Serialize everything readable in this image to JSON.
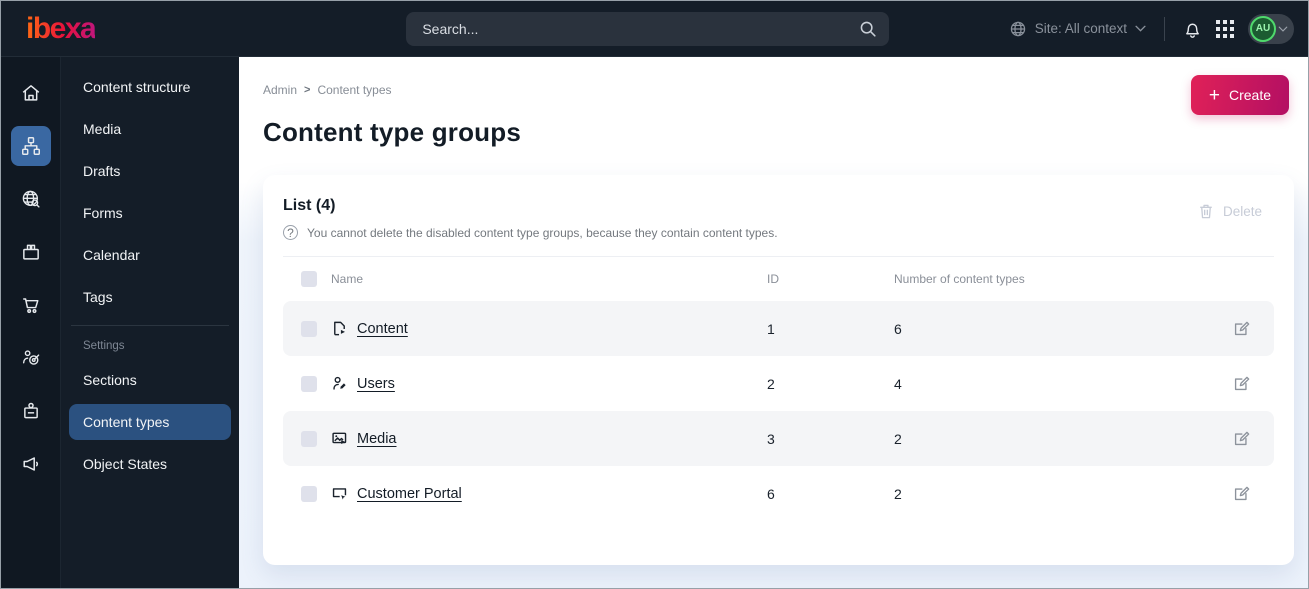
{
  "topbar": {
    "logo": "ibexa",
    "search_placeholder": "Search...",
    "site_context": "Site: All context",
    "avatar": "AU"
  },
  "icon_rail": {
    "items": [
      {
        "name": "home",
        "active": false
      },
      {
        "name": "content-structure",
        "active": true
      },
      {
        "name": "site",
        "active": false
      },
      {
        "name": "products",
        "active": false
      },
      {
        "name": "commerce",
        "active": false
      },
      {
        "name": "personalization",
        "active": false
      },
      {
        "name": "admin",
        "active": false
      },
      {
        "name": "engage",
        "active": false
      }
    ]
  },
  "sidebar": {
    "items": [
      {
        "label": "Content structure"
      },
      {
        "label": "Media"
      },
      {
        "label": "Drafts"
      },
      {
        "label": "Forms"
      },
      {
        "label": "Calendar"
      },
      {
        "label": "Tags"
      }
    ],
    "settings_header": "Settings",
    "settings_items": [
      {
        "label": "Sections",
        "active": false
      },
      {
        "label": "Content types",
        "active": true
      },
      {
        "label": "Object States",
        "active": false
      }
    ]
  },
  "main": {
    "breadcrumb": [
      "Admin",
      "Content types"
    ],
    "breadcrumb_sep": ">",
    "create_plus": "+",
    "create_label": "Create",
    "title": "Content type groups",
    "list": {
      "heading": "List (4)",
      "info_icon": "?",
      "info": "You cannot delete the disabled content type groups, because they contain content types.",
      "delete_label": "Delete",
      "table": {
        "columns": [
          "Name",
          "ID",
          "Number of content types"
        ],
        "rows": [
          {
            "icon": "content-file-icon",
            "name": "Content",
            "id": "1",
            "count": "6"
          },
          {
            "icon": "user-edit-icon",
            "name": "Users",
            "id": "2",
            "count": "4"
          },
          {
            "icon": "media-image-icon",
            "name": "Media",
            "id": "3",
            "count": "2"
          },
          {
            "icon": "portal-screen-icon",
            "name": "Customer Portal",
            "id": "6",
            "count": "2"
          }
        ]
      }
    }
  },
  "icons": {
    "search": "magnifier",
    "site-globe": "globe",
    "notification": "bell",
    "app-grid": "3x3-grid",
    "chevron-down": "v",
    "question": "circled-?",
    "delete": "trash-can",
    "edit": "pencil-square"
  },
  "colors": {
    "topbar_bg": "#141D28",
    "rail_bg": "#101822",
    "active_blue": "#2B5180",
    "rail_active_blue": "#3A68A2",
    "accent_gradient_start": "#E02158",
    "accent_gradient_end": "#B30F63",
    "avatar_green": "#4FD96C",
    "content_bg": "#EFF4FB",
    "stripe": "#F4F5F7",
    "text_dark": "#131C26",
    "text_gray": "#878D96"
  }
}
